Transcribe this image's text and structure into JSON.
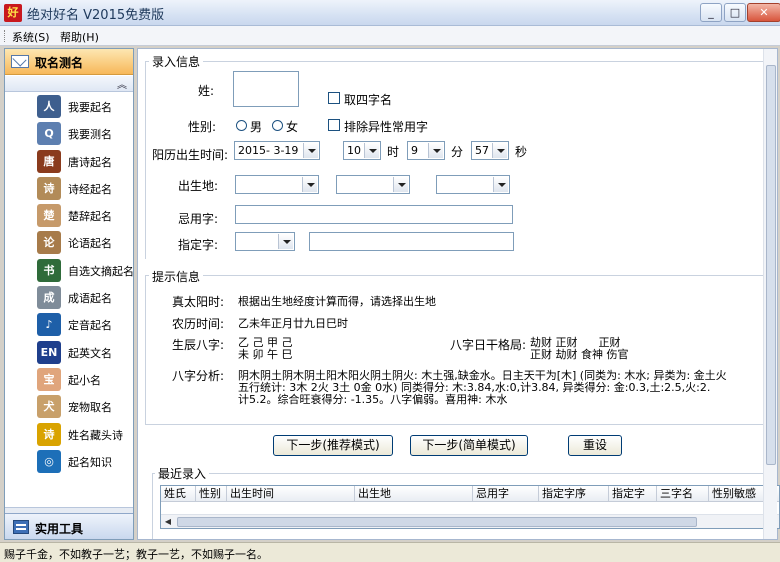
{
  "window": {
    "title": "绝对好名 V2015免费版",
    "icon_text": "好"
  },
  "menu": [
    "系统(S)",
    "帮助(H)"
  ],
  "sidebar": {
    "header": "取名测名",
    "items": [
      {
        "label": "我要起名",
        "icon": "person-icon",
        "color": "#3e5f8e",
        "glyph": "人"
      },
      {
        "label": "我要测名",
        "icon": "magnifier-icon",
        "color": "#5d7fb0",
        "glyph": "Q"
      },
      {
        "label": "唐诗起名",
        "icon": "tang-poem-icon",
        "color": "#8a3b1d",
        "glyph": "唐"
      },
      {
        "label": "诗经起名",
        "icon": "scroll-icon",
        "color": "#b28b58",
        "glyph": "诗"
      },
      {
        "label": "楚辞起名",
        "icon": "scroll-icon-2",
        "color": "#c69a6a",
        "glyph": "楚"
      },
      {
        "label": "论语起名",
        "icon": "book-icon",
        "color": "#a77b4a",
        "glyph": "论"
      },
      {
        "label": "自选文摘起名",
        "icon": "books-stack-icon",
        "color": "#2f6b3a",
        "glyph": "书"
      },
      {
        "label": "成语起名",
        "icon": "idiom-icon",
        "color": "#7f8c99",
        "glyph": "成"
      },
      {
        "label": "定音起名",
        "icon": "sound-icon",
        "color": "#1e5fa8",
        "glyph": "♪"
      },
      {
        "label": "起英文名",
        "icon": "uk-flag-icon",
        "color": "#1f3f8c",
        "glyph": "EN"
      },
      {
        "label": "起小名",
        "icon": "baby-icon",
        "color": "#e0a57c",
        "glyph": "宝"
      },
      {
        "label": "宠物取名",
        "icon": "dog-icon",
        "color": "#c8a06a",
        "glyph": "犬"
      },
      {
        "label": "姓名藏头诗",
        "icon": "poem-icon",
        "color": "#d9a300",
        "glyph": "诗"
      },
      {
        "label": "起名知识",
        "icon": "globe-icon",
        "color": "#1d6fb8",
        "glyph": "◎"
      }
    ],
    "footer": "实用工具"
  },
  "form": {
    "section_input": "录入信息",
    "surname_label": "姓:",
    "four_char_label": "取四字名",
    "gender_label": "性别:",
    "male": "男",
    "female": "女",
    "exclude_label": "排除异性常用字",
    "birth_label": "阳历出生时间:",
    "date_value": "2015- 3-19",
    "hour_value": "10",
    "hour_unit": "时",
    "minute_value": "9",
    "minute_unit": "分",
    "second_value": "57",
    "second_unit": "秒",
    "birthplace_label": "出生地:",
    "avoid_label": "忌用字:",
    "specify_label": "指定字:"
  },
  "hints": {
    "section": "提示信息",
    "solar_label": "真太阳时:",
    "solar_value": "根据出生地经度计算而得，请选择出生地",
    "lunar_label": "农历时间:",
    "lunar_value": "乙未年正月廿九日巳时",
    "bazi_label": "生辰八字:",
    "bazi_row1": "乙 己 甲 己",
    "bazi_row2": "未 卯 午 巳",
    "pattern_label": "八字日干格局:",
    "pattern_row1": "劫财 正财      正财",
    "pattern_row2": "正财 劫财 食神 伤官",
    "analysis_label": "八字分析:",
    "analysis_line1": "阴木阴土阴木阴土阳木阳火阴土阴火: 木土强,缺金水。日主天干为[木] (同类为: 木水; 异类为: 金土火",
    "analysis_line2": "五行统计: 3木 2火 3土 0金 0水) 同类得分: 木:3.84,水:0,计3.84, 异类得分: 金:0.3,土:2.5,火:2.",
    "analysis_line3": "计5.2。综合旺衰得分: -1.35。八字偏弱。喜用神: 木水"
  },
  "buttons": {
    "next_recommended": "下一步(推荐模式)",
    "next_simple": "下一步(简单模式)",
    "reset": "重设"
  },
  "recent": {
    "section": "最近录入",
    "columns": [
      "姓氏",
      "性别",
      "出生时间",
      "出生地",
      "忌用字",
      "指定字序",
      "指定字",
      "三字名",
      "性别敏感"
    ]
  },
  "status": "赐子千金，不如教子一艺；教子一艺，不如赐子一名。"
}
